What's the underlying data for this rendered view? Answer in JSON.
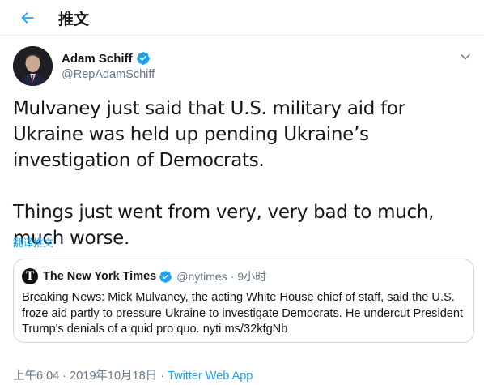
{
  "header": {
    "title": "推文"
  },
  "tweet": {
    "author_name": "Adam Schiff",
    "author_handle": "@RepAdamSchiff",
    "text": "Mulvaney just said that U.S. military aid for Ukraine was held up pending Ukraine’s investigation of Democrats.\n\nThings just went from very, very bad to much, much worse.",
    "translate_label": "翻译推文",
    "time": "上午6:04",
    "separator_1": "·",
    "date": "2019年10月18日",
    "separator_2": "·",
    "source": "Twitter Web App"
  },
  "quoted_tweet": {
    "author_name": "The New York Times",
    "author_handle": "@nytimes",
    "separator": "·",
    "time_ago": "9小时",
    "text": "Breaking News: Mick Mulvaney, the acting White House chief of staff, said the U.S. froze aid partly to pressure Ukraine to investigate Democrats. He undercut President Trump's denials of a quid pro quo. nyti.ms/32kfgNb"
  },
  "icons": {
    "back": "arrow-left-icon",
    "verified": "verified-badge-icon",
    "menu": "chevron-down-icon",
    "nyt_logo": "nyt-logo-icon"
  },
  "colors": {
    "accent": "#1da1f2",
    "text": "#14171a",
    "secondary": "#657786",
    "border": "#ccd6dd"
  }
}
